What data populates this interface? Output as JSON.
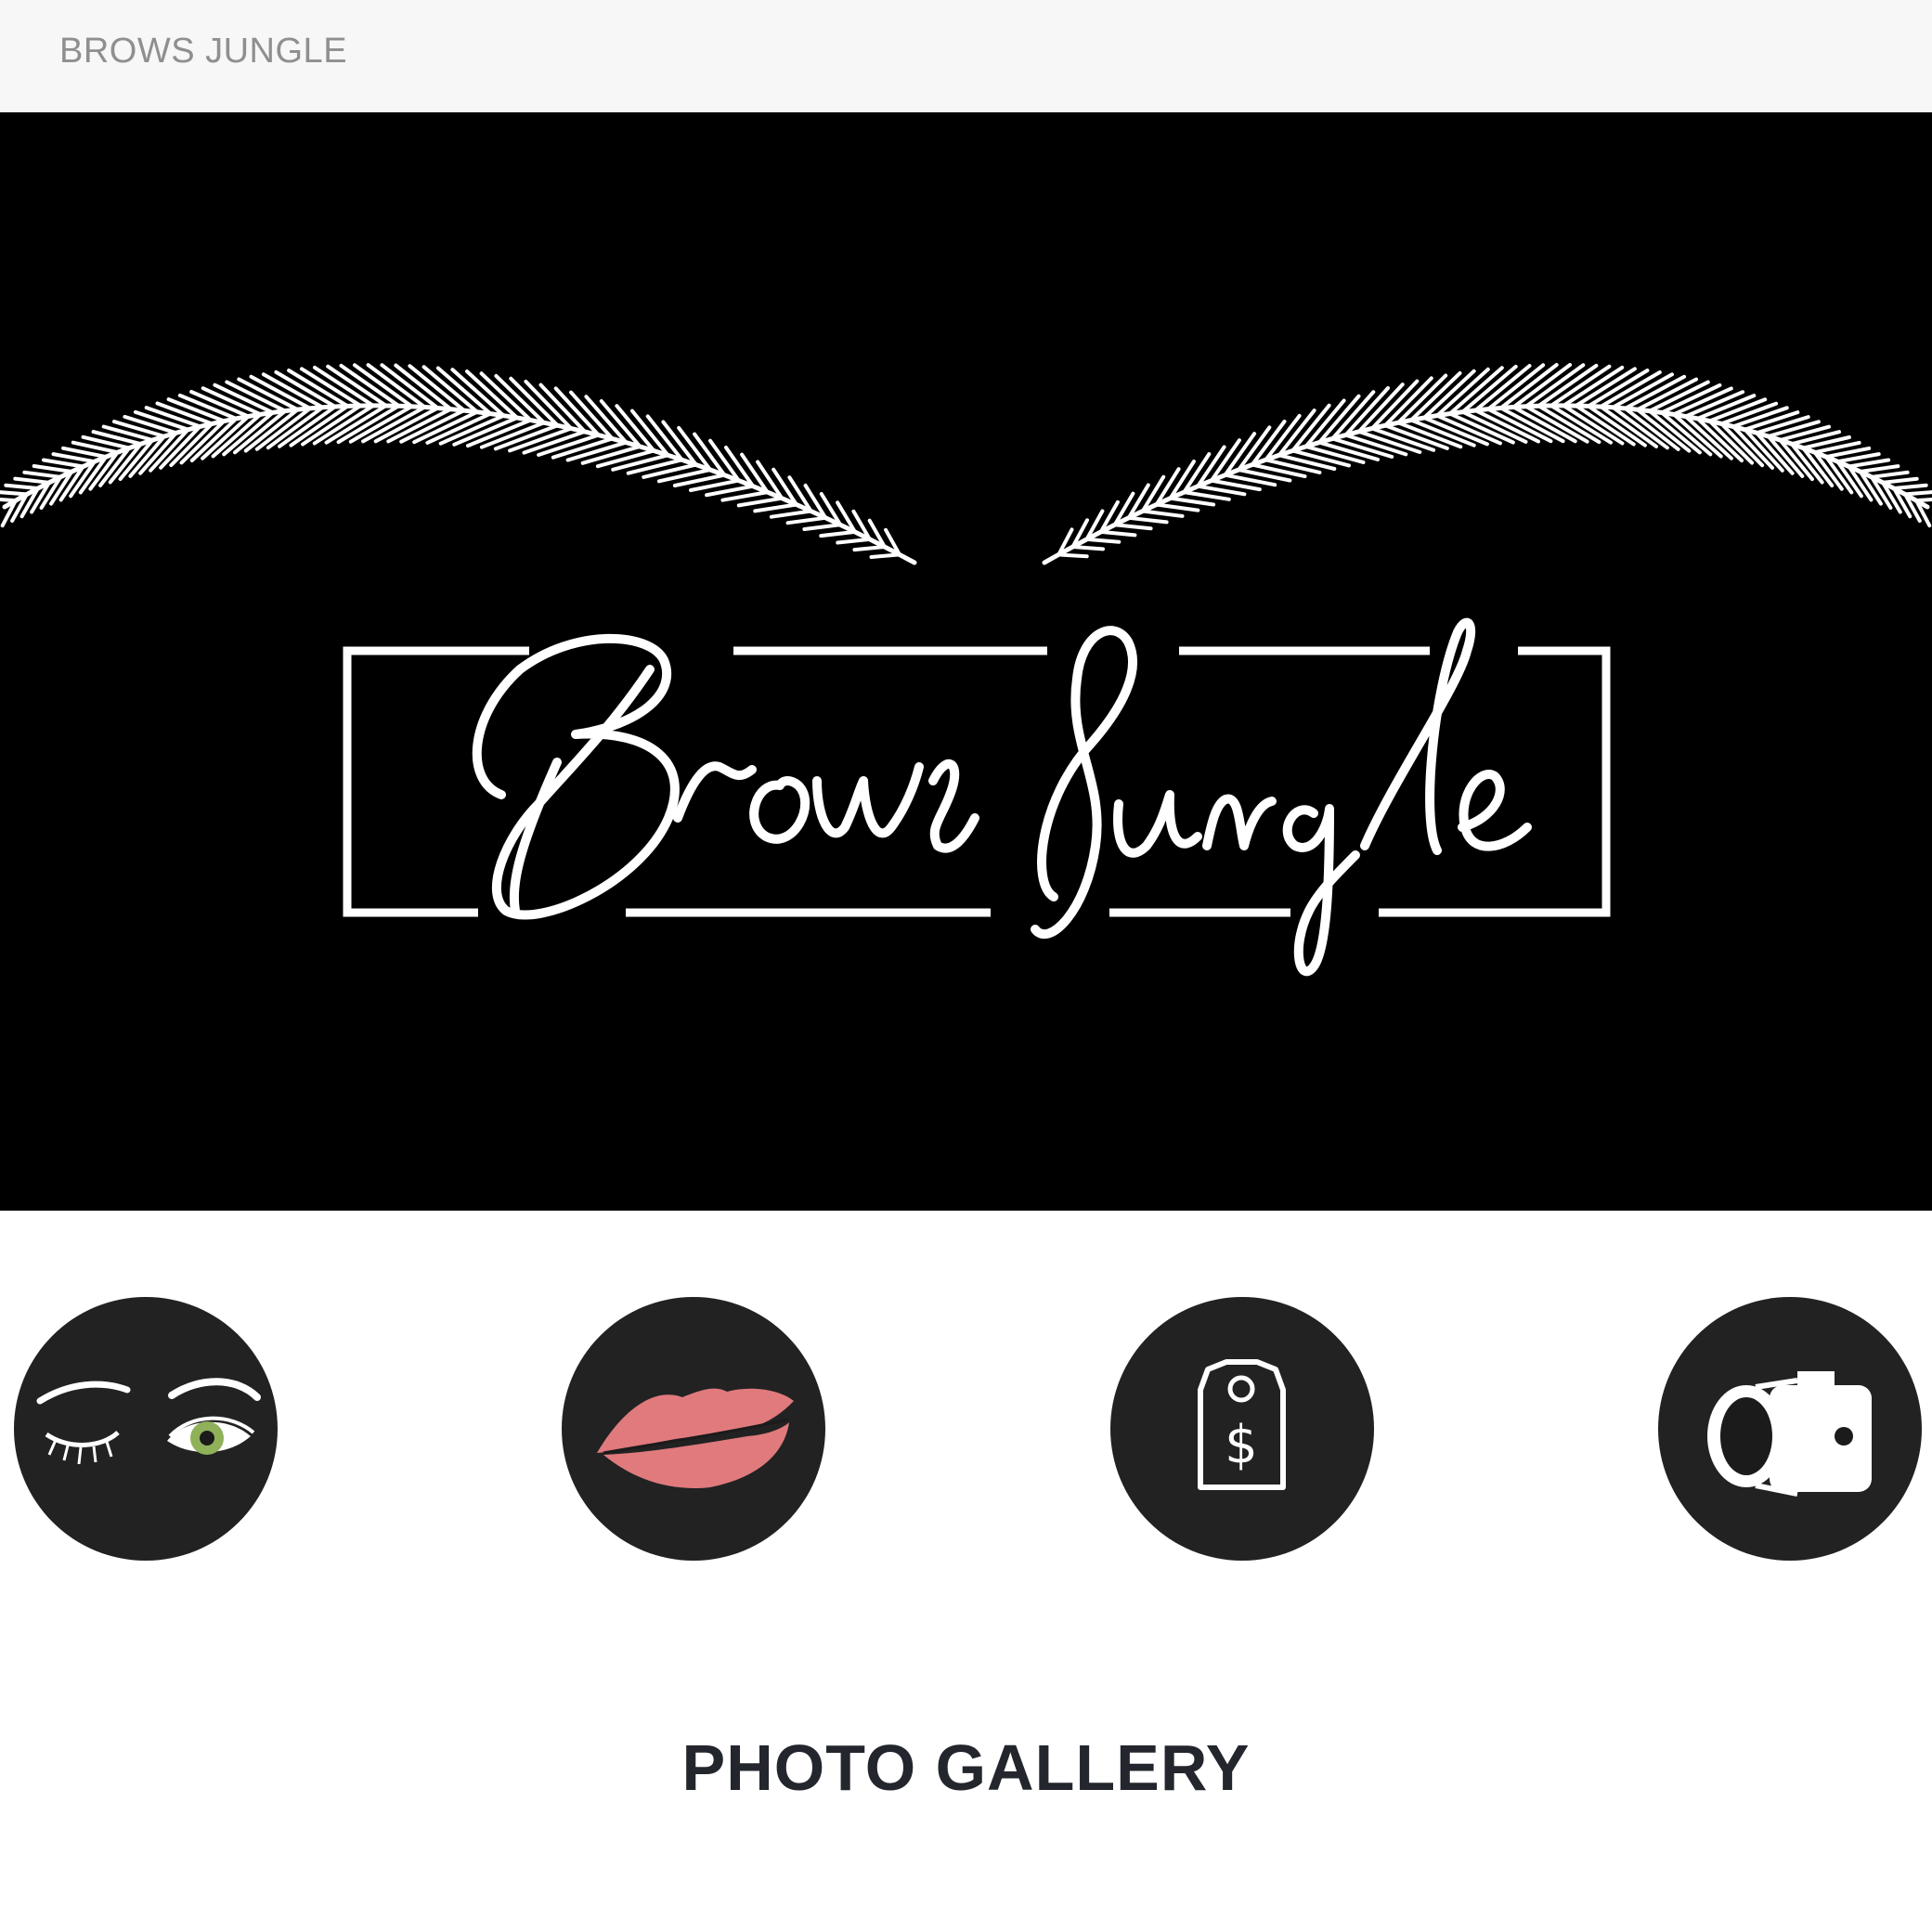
{
  "header": {
    "brand": "BROWS JUNGLE"
  },
  "hero": {
    "logo_text": "Brows Jungle",
    "background": "#000000",
    "foreground": "#ffffff"
  },
  "icon_links": [
    {
      "icon": "eyes-wink-icon",
      "accent": "#8fb15a"
    },
    {
      "icon": "lips-kiss-icon",
      "accent": "#e07a7d"
    },
    {
      "icon": "price-tag-dollar-icon",
      "accent": "#ffffff"
    },
    {
      "icon": "camera-icon",
      "accent": "#ffffff"
    }
  ],
  "gallery": {
    "title": "PHOTO GALLERY"
  },
  "colors": {
    "topbar_bg": "#f7f7f7",
    "circle_bg": "#222222",
    "title_text": "#23262d"
  }
}
